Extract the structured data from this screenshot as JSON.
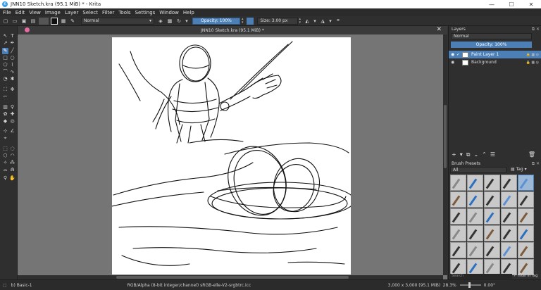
{
  "window": {
    "title": "JNN10 Sketch.kra (95.1 MiB)  * - Krita",
    "min": "—",
    "max": "☐",
    "close": "✕"
  },
  "menu": [
    "File",
    "Edit",
    "View",
    "Image",
    "Layer",
    "Select",
    "Filter",
    "Tools",
    "Settings",
    "Window",
    "Help"
  ],
  "toolbar": {
    "blend_mode": "Normal",
    "opacity": "Opacity: 100%",
    "size": "Size: 3.00 px"
  },
  "document": {
    "tab_title": "JNN10 Sketch.kra (95.1 MiB) *"
  },
  "layers": {
    "title": "Layers",
    "blend_mode": "Normal",
    "opacity": "Opacity:  100%",
    "items": [
      {
        "name": "Paint Layer 1",
        "selected": true
      },
      {
        "name": "Background",
        "selected": false
      }
    ]
  },
  "brush_presets": {
    "title": "Brush Presets",
    "filter": "All",
    "tag_label": "Tag",
    "search_placeholder": "Search",
    "filter_in_tag": "Filter in Tag"
  },
  "status": {
    "brush": "b) Basic-1",
    "color_space": "RGB/Alpha (8-bit integer/channel)  sRGB-elle-V2-srgbtrc.icc",
    "dimensions": "3,000 x 3,000 (95.1 MiB)",
    "zoom": "28.3%",
    "rotation": "0.00°"
  }
}
